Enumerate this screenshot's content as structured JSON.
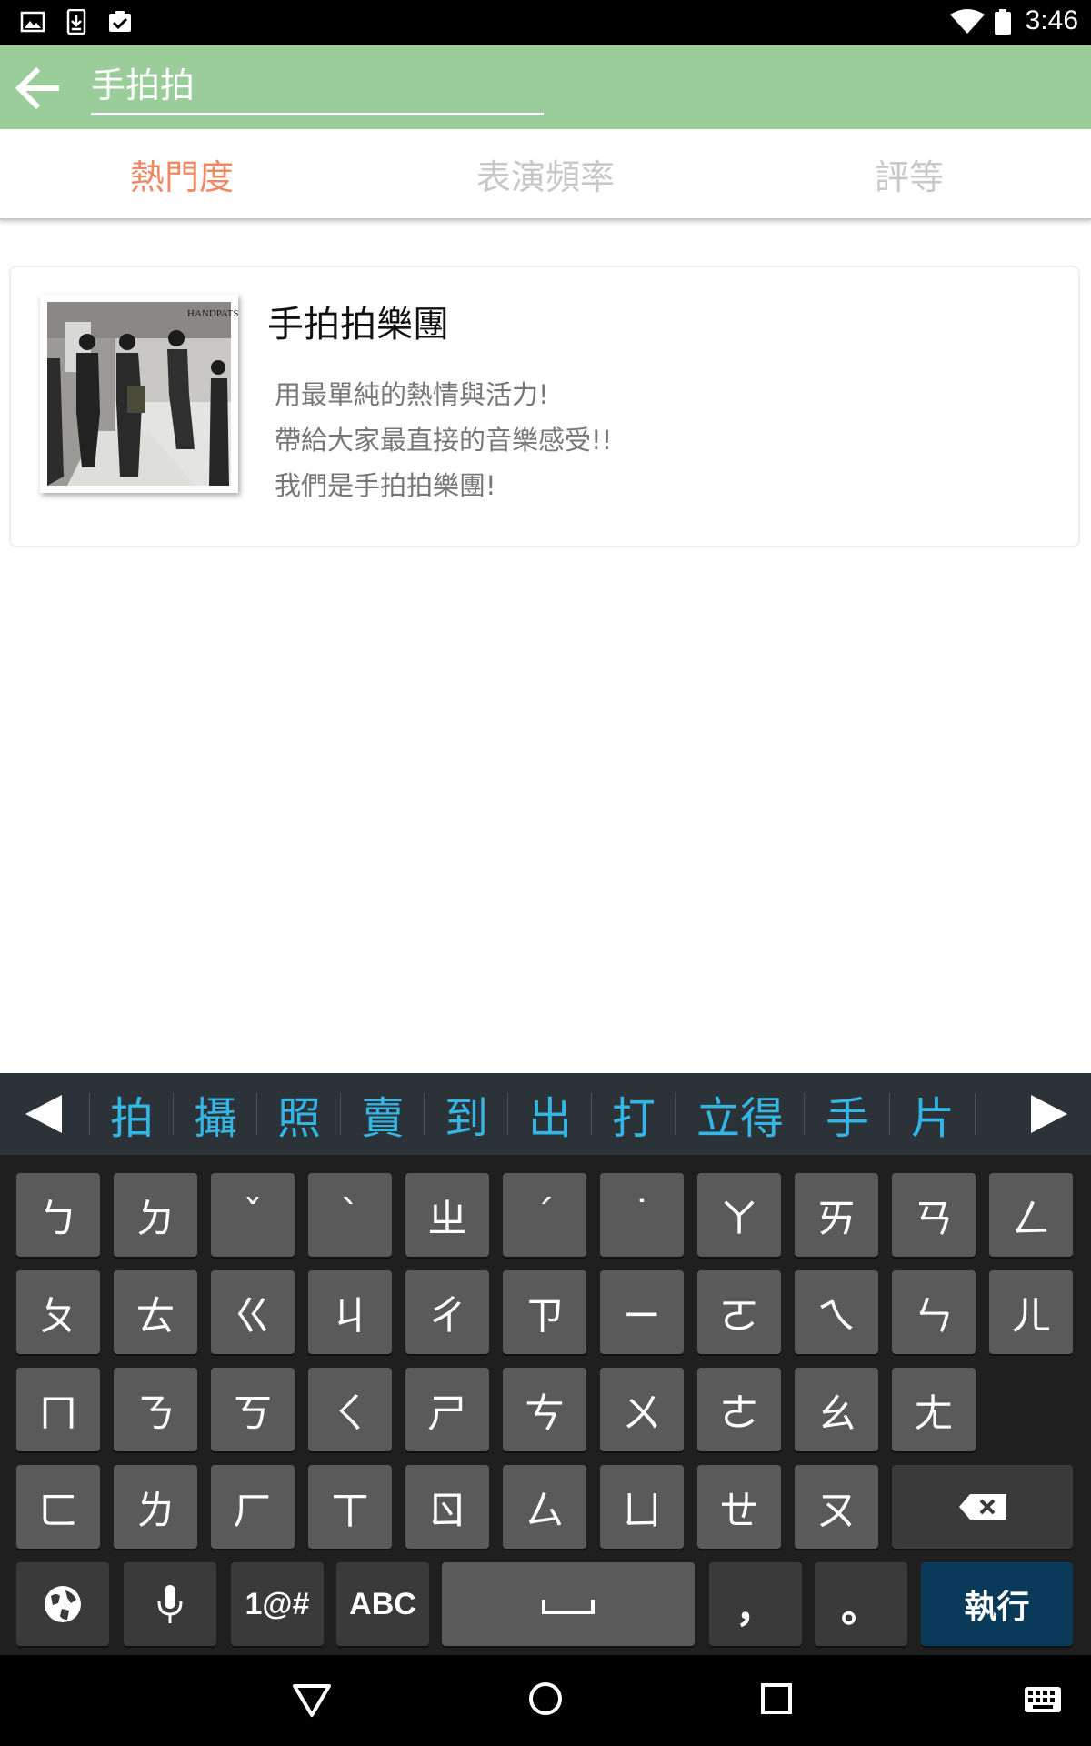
{
  "status_bar": {
    "time": "3:46"
  },
  "search": {
    "value": "手拍拍"
  },
  "tabs": [
    {
      "label": "熱門度",
      "active": true
    },
    {
      "label": "表演頻率",
      "active": false
    },
    {
      "label": "評等",
      "active": false
    }
  ],
  "results": [
    {
      "name": "手拍拍樂團",
      "description": [
        "用最單純的熱情與活力!",
        "帶給大家最直接的音樂感受!!",
        "我們是手拍拍樂團!"
      ],
      "thumbnail_text": "HANDPATS"
    }
  ],
  "keyboard": {
    "candidates": [
      "拍",
      "攝",
      "照",
      "賣",
      "到",
      "出",
      "打",
      "立得",
      "手",
      "片"
    ],
    "row1": [
      "ㄅ",
      "ㄉ",
      "ˇ",
      "ˋ",
      "ㄓ",
      "ˊ",
      "˙",
      "ㄚ",
      "ㄞ",
      "ㄢ",
      "ㄥ"
    ],
    "row2": [
      "ㄆ",
      "ㄊ",
      "ㄍ",
      "ㄐ",
      "ㄔ",
      "ㄗ",
      "ㄧ",
      "ㄛ",
      "ㄟ",
      "ㄣ",
      "ㄦ"
    ],
    "row3": [
      "ㄇ",
      "ㄋ",
      "ㄎ",
      "ㄑ",
      "ㄕ",
      "ㄘ",
      "ㄨ",
      "ㄜ",
      "ㄠ",
      "ㄤ"
    ],
    "row4": [
      "ㄈ",
      "ㄌ",
      "ㄏ",
      "ㄒ",
      "ㄖ",
      "ㄙ",
      "ㄩ",
      "ㄝ",
      "ㄡ"
    ],
    "symbols_label": "1@#",
    "abc_label": "ABC",
    "comma": "，",
    "period": "。",
    "enter_label": "執行"
  },
  "colors": {
    "app_bar": "#9acd9a",
    "active_tab": "#f08763",
    "inactive_tab": "#c8c8c8",
    "candidate_text": "#33b5e5",
    "enter_key": "#0a3a5a"
  }
}
